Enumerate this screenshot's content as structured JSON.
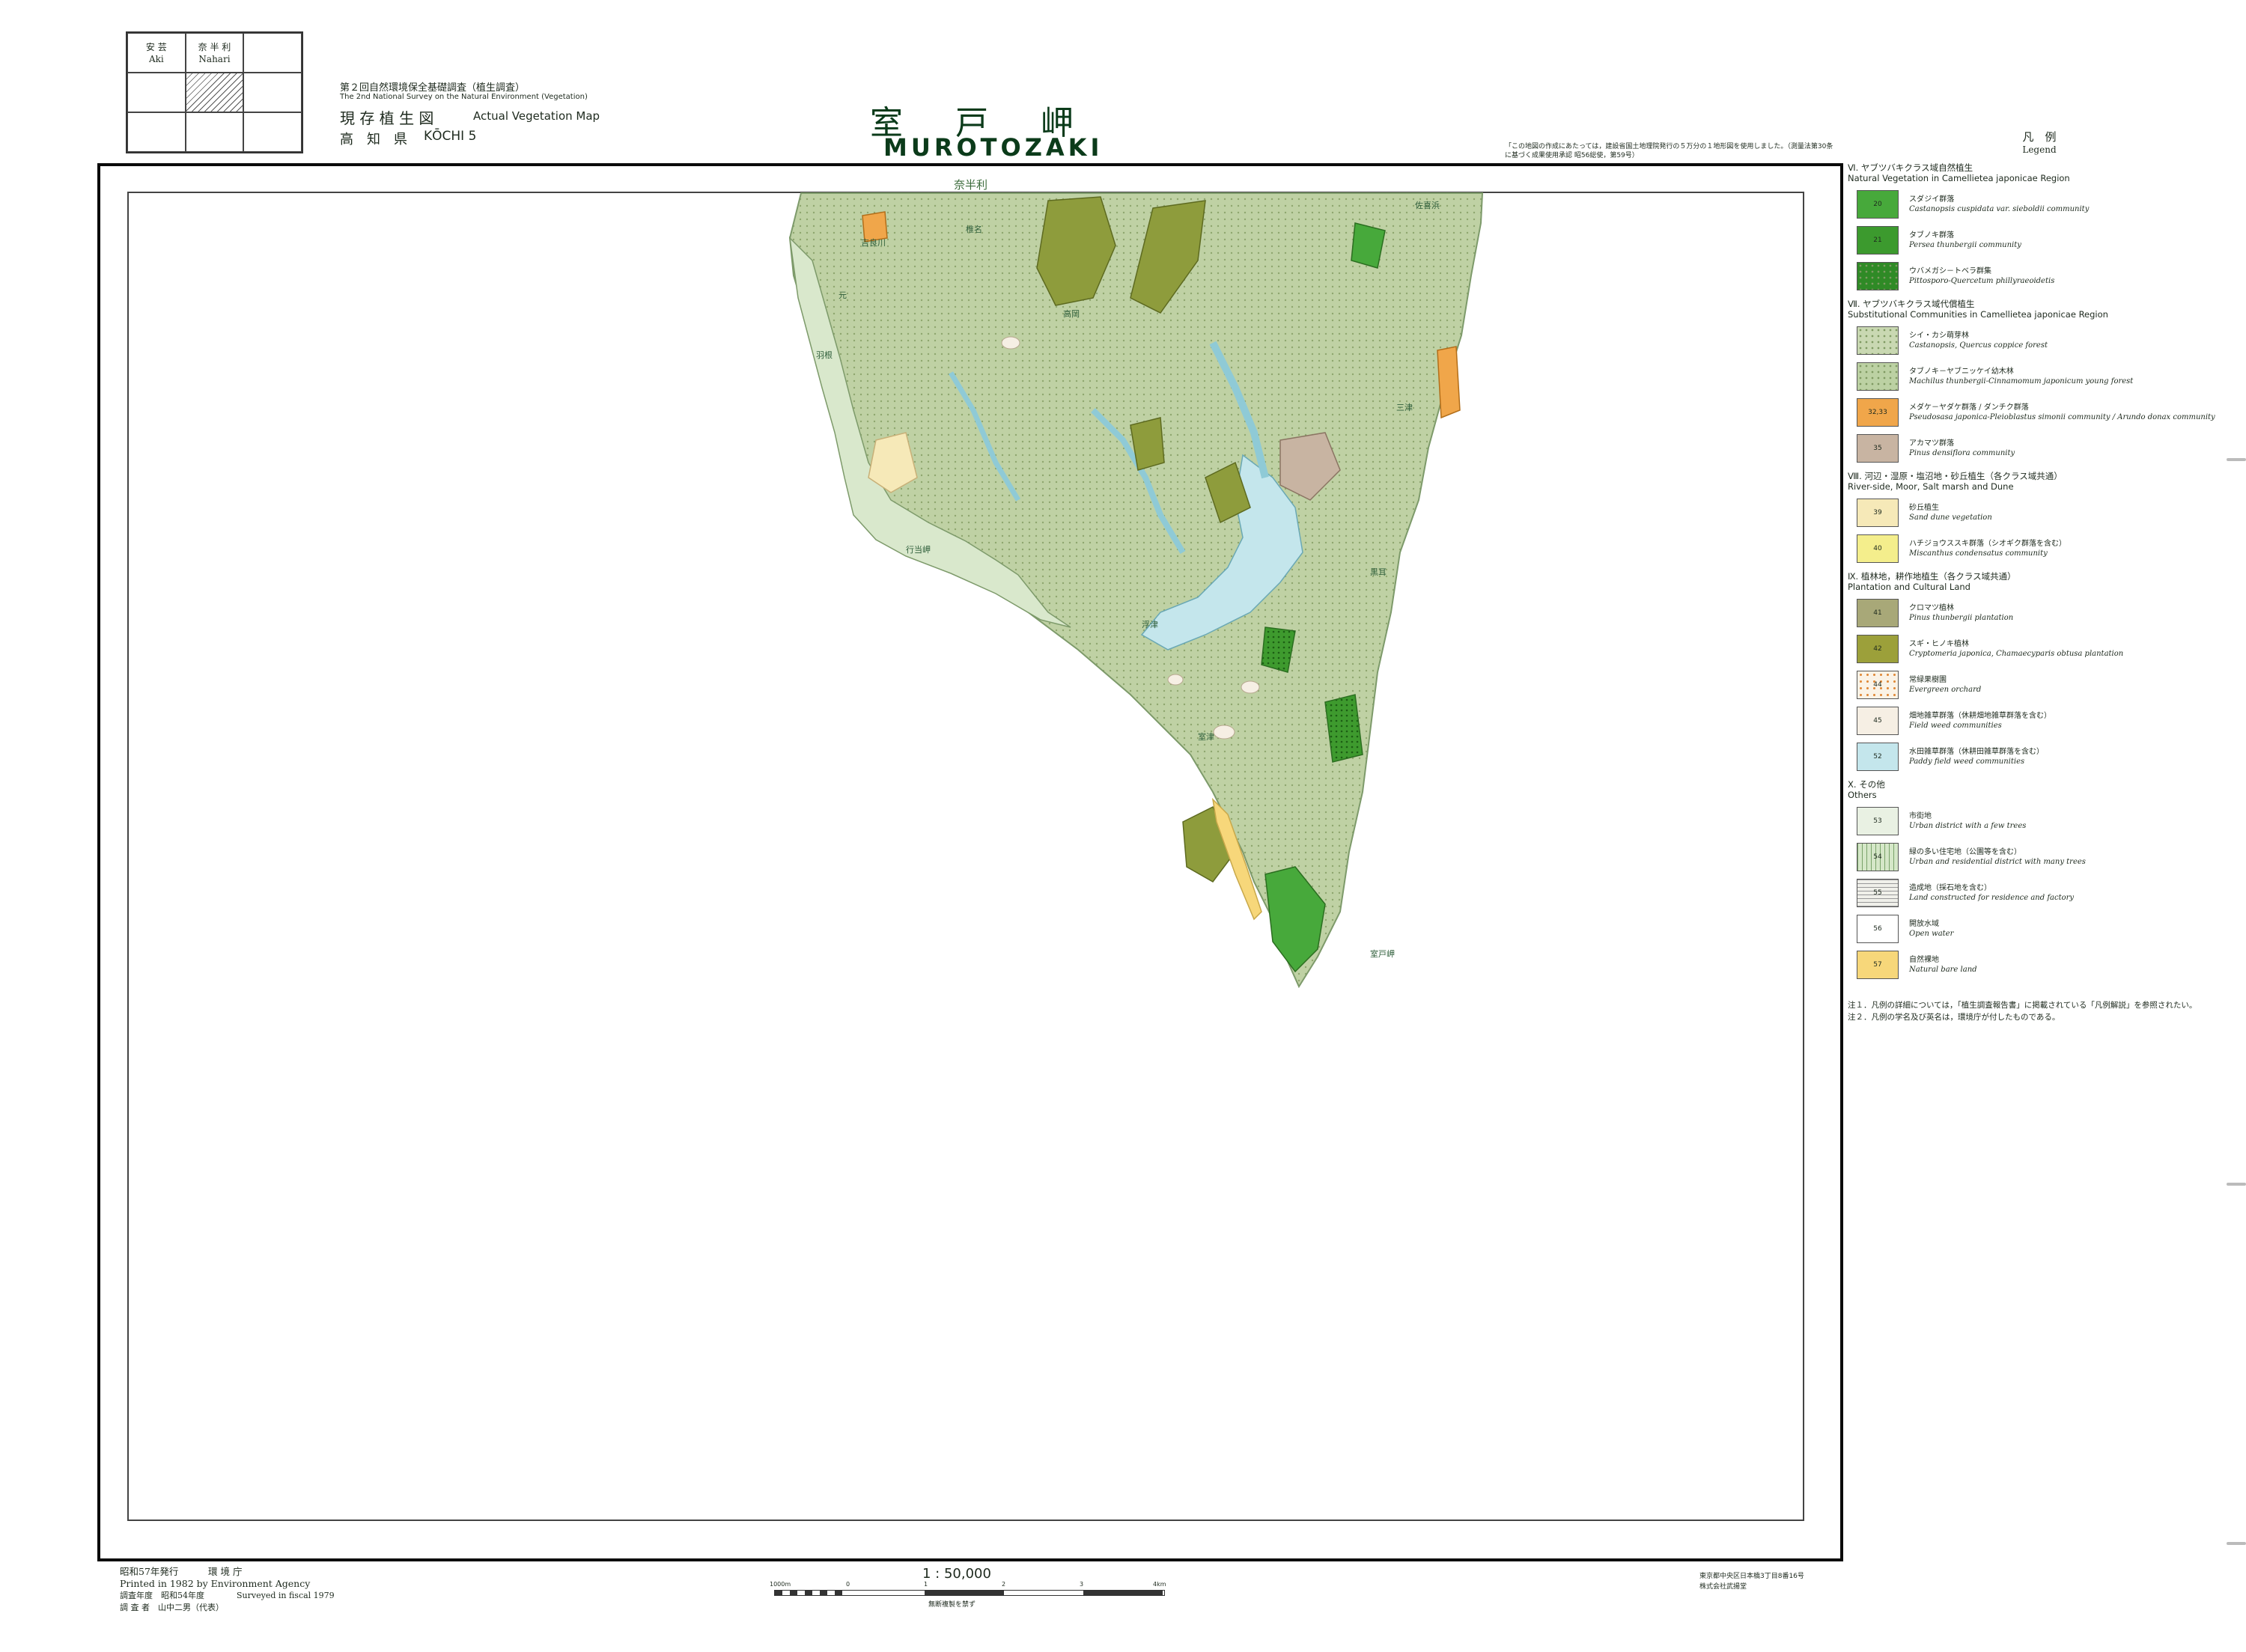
{
  "index_map": {
    "cells": [
      {
        "jp": "安 芸",
        "en": "Aki"
      },
      {
        "jp": "奈 半 利",
        "en": "Nahari"
      },
      {
        "jp": "",
        "en": ""
      },
      {
        "jp": "",
        "en": ""
      },
      {
        "jp": "",
        "en": "",
        "hatched": true
      },
      {
        "jp": "",
        "en": ""
      },
      {
        "jp": "",
        "en": ""
      },
      {
        "jp": "",
        "en": ""
      },
      {
        "jp": "",
        "en": ""
      }
    ]
  },
  "header": {
    "survey_jp": "第２回自然環境保全基礎調査（植生調査）",
    "survey_en": "The 2nd National Survey on the Natural Environment (Vegetation)",
    "map_type_jp": "現 存 植 生 図",
    "map_type_en": "Actual Vegetation Map",
    "prefecture_jp": "高　知　県",
    "sheet_code": "KŌCHI 5",
    "title_jp": "室 戸 岬",
    "title_en": "MUROTOZAKI",
    "top_note": "「この地図の作成にあたっては，建設省国土地理院発行の５万分の１地形図を使用しました。（測量法第30条に基づく成果使用承認 昭56総使，第59号）"
  },
  "legend": {
    "title_jp": "凡　例",
    "title_en": "Legend",
    "sections": [
      {
        "heading_jp": "Ⅵ. ヤブツバキクラス域自然植生",
        "heading_en": "Natural Vegetation in Camellietea japonicae Region",
        "items": [
          {
            "code": "20",
            "color": "#47a93b",
            "pattern": "solid",
            "jp": "スダジイ群落",
            "en": "Castanopsis cuspidata var. sieboldii community"
          },
          {
            "code": "21",
            "color": "#3c9a2e",
            "pattern": "solid",
            "jp": "タブノキ群落",
            "en": "Persea thunbergii community"
          },
          {
            "code": "",
            "color": "#2f8a26",
            "pattern": "dots",
            "jp": "ウバメガシ－トベラ群集",
            "en": "Pittosporo-Quercetum phillyraeoidetis"
          }
        ]
      },
      {
        "heading_jp": "Ⅶ. ヤブツバキクラス域代償植生",
        "heading_en": "Substitutional Communities in Camellietea japonicae Region",
        "items": [
          {
            "code": "",
            "color": "#c9d8b2",
            "pattern": "dots",
            "jp": "シイ・カシ萌芽林",
            "en": "Castanopsis, Quercus coppice forest"
          },
          {
            "code": "",
            "color": "#bcd1a3",
            "pattern": "dots",
            "jp": "タブノキ－ヤブニッケイ幼木林",
            "en": "Machilus thunbergii-Cinnamomum japonicum young forest"
          },
          {
            "code": "32,33",
            "color": "#f0a64a",
            "pattern": "solid",
            "jp": "メダケ－ヤダケ群落 / ダンチク群落",
            "en": "Pseudosasa japonica-Pleioblastus simonii community / Arundo donax community"
          },
          {
            "code": "35",
            "color": "#c8b4a2",
            "pattern": "solid",
            "jp": "アカマツ群落",
            "en": "Pinus densiflora community"
          }
        ]
      },
      {
        "heading_jp": "Ⅷ. 河辺・湿原・塩沼地・砂丘植生（各クラス域共通）",
        "heading_en": "River-side, Moor, Salt marsh and Dune",
        "items": [
          {
            "code": "39",
            "color": "#f6e9b8",
            "pattern": "solid",
            "jp": "砂丘植生",
            "en": "Sand dune vegetation"
          },
          {
            "code": "40",
            "color": "#f4ee8c",
            "pattern": "solid",
            "jp": "ハチジョウススキ群落（シオギク群落を含む）",
            "en": "Miscanthus condensatus community"
          }
        ]
      },
      {
        "heading_jp": "Ⅸ. 植林地，耕作地植生（各クラス域共通）",
        "heading_en": "Plantation and Cultural Land",
        "items": [
          {
            "code": "41",
            "color": "#a8a878",
            "pattern": "solid",
            "jp": "クロマツ植林",
            "en": "Pinus thunbergii plantation"
          },
          {
            "code": "42",
            "color": "#9ca03a",
            "pattern": "solid",
            "jp": "スギ・ヒノキ植林",
            "en": "Cryptomeria japonica, Chamaecyparis obtusa plantation"
          },
          {
            "code": "44",
            "color": "#fbf3e6",
            "pattern": "dots-orange",
            "jp": "常緑果樹園",
            "en": "Evergreen orchard"
          },
          {
            "code": "45",
            "color": "#f6efe4",
            "pattern": "solid",
            "jp": "畑地雑草群落（休耕畑地雑草群落を含む）",
            "en": "Field weed communities"
          },
          {
            "code": "52",
            "color": "#c4e6ec",
            "pattern": "solid",
            "jp": "水田雑草群落（休耕田雑草群落を含む）",
            "en": "Paddy field weed communities"
          }
        ]
      },
      {
        "heading_jp": "Ⅹ. その他",
        "heading_en": "Others",
        "items": [
          {
            "code": "53",
            "color": "#e9f1e3",
            "pattern": "solid",
            "jp": "市街地",
            "en": "Urban district with a few trees"
          },
          {
            "code": "54",
            "color": "#d5e7c8",
            "pattern": "hatch",
            "jp": "緑の多い住宅地（公園等を含む）",
            "en": "Urban and residential district with many trees"
          },
          {
            "code": "55",
            "color": "#f0f0ea",
            "pattern": "lines",
            "jp": "造成地（採石地を含む）",
            "en": "Land constructed for residence and factory"
          },
          {
            "code": "56",
            "color": "#ffffff",
            "pattern": "solid",
            "jp": "開放水域",
            "en": "Open water"
          },
          {
            "code": "57",
            "color": "#f7d77a",
            "pattern": "solid",
            "jp": "自然裸地",
            "en": "Natural bare land"
          }
        ]
      }
    ],
    "notes": [
      "注１．凡例の詳細については，「植生調査報告書」に掲載されている「凡例解説」を参照されたい。",
      "注２．凡例の学名及び英名は，環境庁が付したものである。"
    ]
  },
  "footer": {
    "published_jp": "昭和57年発行",
    "agency_jp": "環 境 庁",
    "printed": "Printed in 1982 by Environment Agency",
    "surveyed_jp": "調査年度　昭和54年度",
    "surveyed_en": "Surveyed in fiscal 1979",
    "investigator": "調 査 者　山中二男（代表）",
    "scale": "1 : 50,000",
    "scale_ticks": [
      "1000m",
      "0",
      "1",
      "2",
      "3",
      "4km"
    ],
    "scale_note": "無断複製を禁ず",
    "printer_address": "東京都中央区日本橋3丁目8番16号",
    "printer_name": "株式会社武揚堂"
  },
  "map": {
    "adjacent_sheet": "奈半利",
    "place_labels": [
      "吉良川",
      "室戸岬",
      "元",
      "羽根",
      "行当岬",
      "高岡",
      "浮津",
      "室津",
      "佐喜浜",
      "三津",
      "椎名",
      "黒耳"
    ]
  }
}
